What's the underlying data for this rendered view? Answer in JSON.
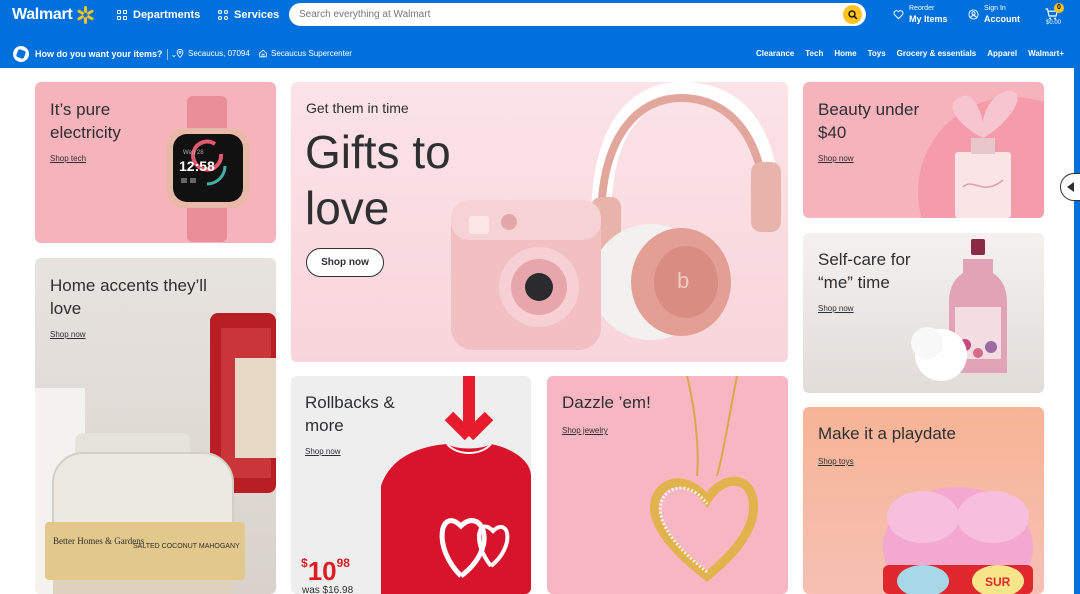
{
  "header": {
    "logo_text": "Walmart",
    "departments_label": "Departments",
    "services_label": "Services",
    "search_placeholder": "Search everything at Walmart",
    "reorder_small": "Reorder",
    "reorder_big": "My Items",
    "signin_small": "Sign In",
    "signin_big": "Account",
    "cart_count": "0",
    "cart_total": "$0.00",
    "brand_color": "#0071dc",
    "accent_color": "#ffc220"
  },
  "subnav": {
    "how_label": "How do you want your items?",
    "zip": "Secaucus, 07094",
    "store": "Secaucus Supercenter",
    "categories": [
      "Clearance",
      "Tech",
      "Home",
      "Toys",
      "Grocery & essentials",
      "Apparel",
      "Walmart+"
    ]
  },
  "cards": {
    "electricity": {
      "title": "It’s pure electricity",
      "link": "Shop tech",
      "watch_time": "12:58",
      "watch_date": "Wed 28"
    },
    "gifts": {
      "eyebrow": "Get them in time",
      "title": "Gifts to love",
      "button": "Shop now"
    },
    "beauty": {
      "title": "Beauty under $40",
      "link": "Shop now"
    },
    "home": {
      "title": "Home accents they’ll love",
      "link": "Shop now",
      "candle_brand": "Better Homes & Gardens",
      "candle_scent": "SALTED COCONUT MAHOGANY"
    },
    "selfcare": {
      "title": "Self-care for “me” time",
      "link": "Shop now"
    },
    "rollbacks": {
      "title": "Rollbacks & more",
      "link": "Shop now",
      "price_dollar": "$",
      "price_whole": "10",
      "price_cents": "98",
      "was_price": "was $16.98"
    },
    "dazzle": {
      "title": "Dazzle ’em!",
      "link": "Shop jewelry"
    },
    "playdate": {
      "title": "Make it a playdate",
      "link": "Shop toys",
      "toy_text": "SUR"
    }
  }
}
